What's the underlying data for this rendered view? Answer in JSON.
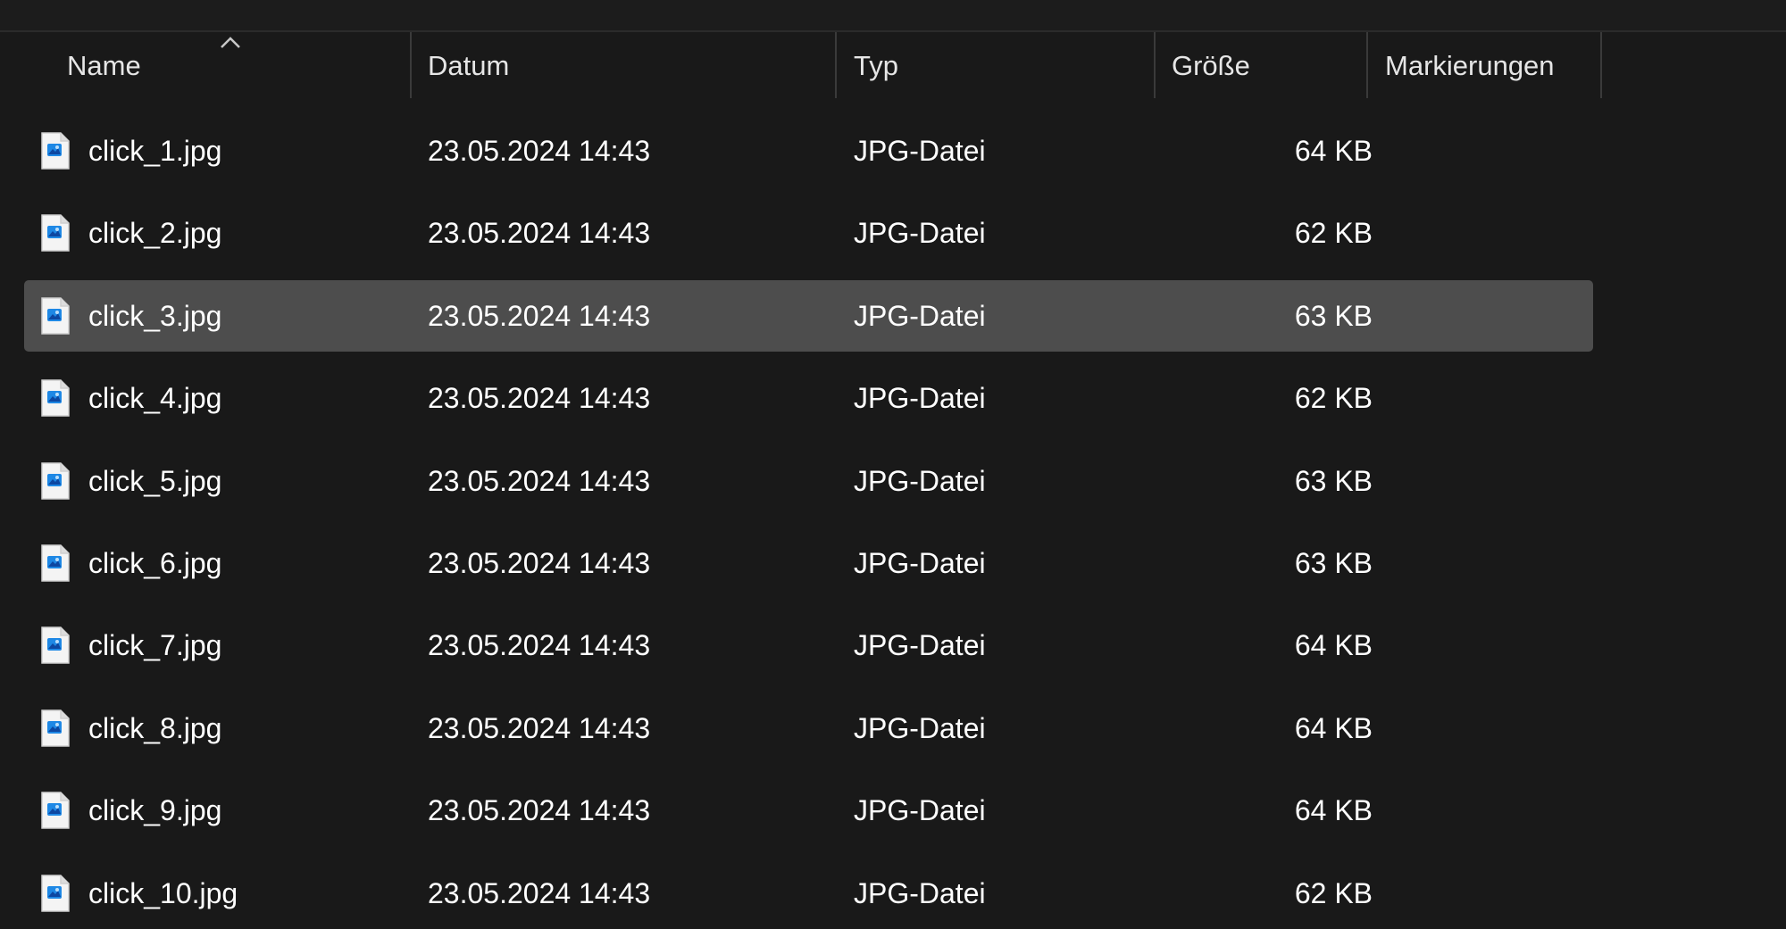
{
  "columns": {
    "name": "Name",
    "date": "Datum",
    "type": "Typ",
    "size": "Größe",
    "tags": "Markierungen"
  },
  "sort": {
    "column": "name",
    "direction": "ascending"
  },
  "selected_index": 2,
  "files": [
    {
      "name": "click_1.jpg",
      "date": "23.05.2024 14:43",
      "type": "JPG-Datei",
      "size": "64 KB"
    },
    {
      "name": "click_2.jpg",
      "date": "23.05.2024 14:43",
      "type": "JPG-Datei",
      "size": "62 KB"
    },
    {
      "name": "click_3.jpg",
      "date": "23.05.2024 14:43",
      "type": "JPG-Datei",
      "size": "63 KB"
    },
    {
      "name": "click_4.jpg",
      "date": "23.05.2024 14:43",
      "type": "JPG-Datei",
      "size": "62 KB"
    },
    {
      "name": "click_5.jpg",
      "date": "23.05.2024 14:43",
      "type": "JPG-Datei",
      "size": "63 KB"
    },
    {
      "name": "click_6.jpg",
      "date": "23.05.2024 14:43",
      "type": "JPG-Datei",
      "size": "63 KB"
    },
    {
      "name": "click_7.jpg",
      "date": "23.05.2024 14:43",
      "type": "JPG-Datei",
      "size": "64 KB"
    },
    {
      "name": "click_8.jpg",
      "date": "23.05.2024 14:43",
      "type": "JPG-Datei",
      "size": "64 KB"
    },
    {
      "name": "click_9.jpg",
      "date": "23.05.2024 14:43",
      "type": "JPG-Datei",
      "size": "64 KB"
    },
    {
      "name": "click_10.jpg",
      "date": "23.05.2024 14:43",
      "type": "JPG-Datei",
      "size": "62 KB"
    }
  ],
  "colors": {
    "background": "#191919",
    "selected_row": "#4d4d4d",
    "divider": "#3a3a3a",
    "icon_accent": "#1e88e5"
  },
  "icons": {
    "file": "jpg-file-icon",
    "sort": "sort-ascending-caret-icon"
  }
}
